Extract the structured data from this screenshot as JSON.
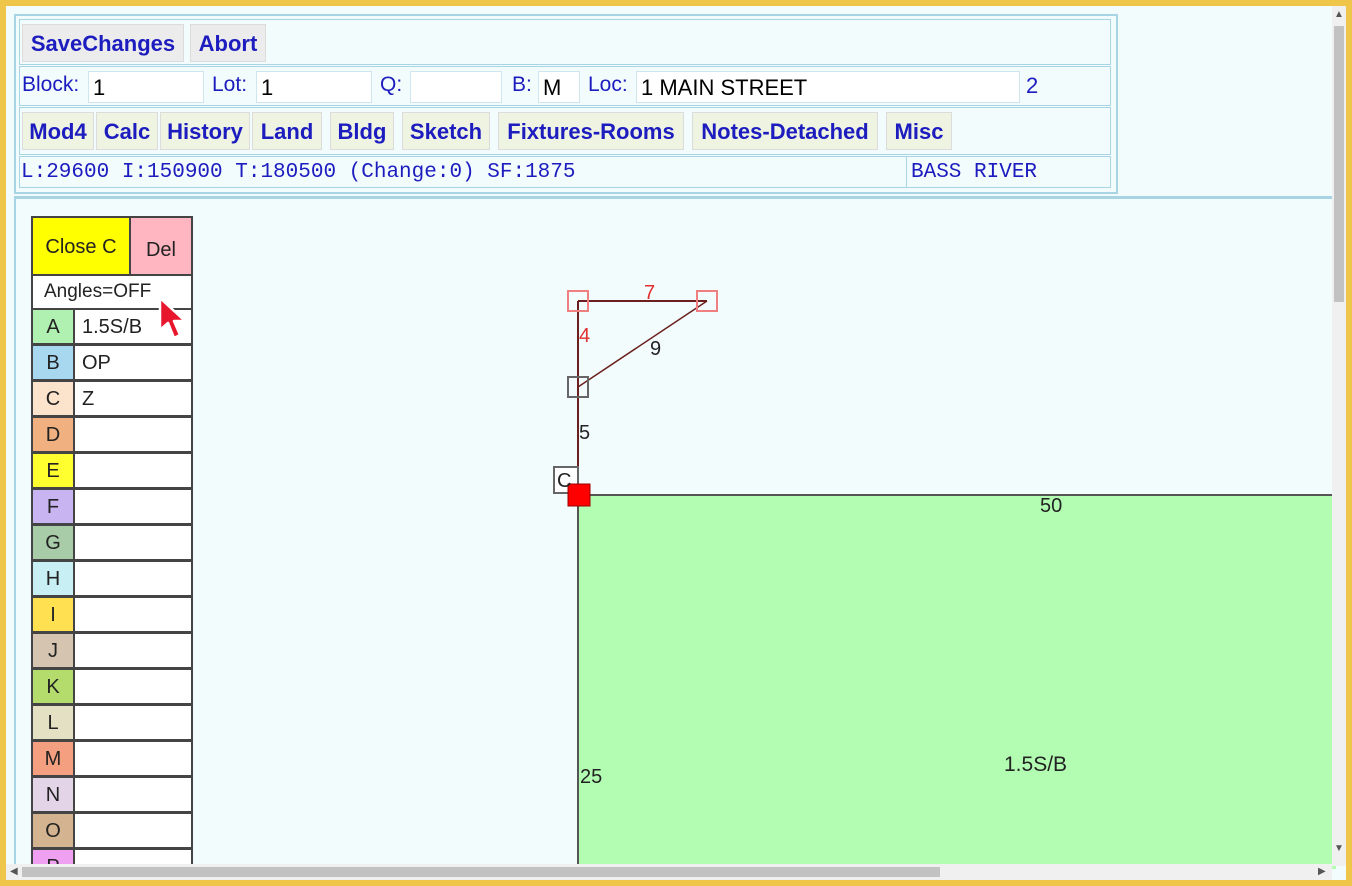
{
  "toolbar": {
    "save_label": "SaveChanges",
    "abort_label": "Abort"
  },
  "parcel": {
    "block_label": "Block:",
    "block_value": "1",
    "lot_label": "Lot:",
    "lot_value": "1",
    "q_label": "Q:",
    "q_value": "",
    "b_label": "B:",
    "b_value": "M",
    "loc_label": "Loc:",
    "loc_value": "1 MAIN STREET",
    "extra_value": "2"
  },
  "nav": {
    "items": [
      "Mod4",
      "Calc",
      "History",
      "Land",
      "Bldg",
      "Sketch",
      "Fixtures-Rooms",
      "Notes-Detached",
      "Misc"
    ]
  },
  "status": {
    "values_text": "L:29600 I:150900 T:180500 (Change:0) SF:1875",
    "town": "BASS RIVER"
  },
  "palette": {
    "close_label": "Close C",
    "del_label": "Del",
    "angles_label": "Angles=OFF",
    "close_color": "#ffff00",
    "del_color": "#ffb6c1",
    "rows": [
      {
        "letter": "A",
        "code": "1.5S/B",
        "color": "#b0f0b0"
      },
      {
        "letter": "B",
        "code": "OP",
        "color": "#a8d8f0"
      },
      {
        "letter": "C",
        "code": "Z",
        "color": "#fce4cc"
      },
      {
        "letter": "D",
        "code": "",
        "color": "#f0b080"
      },
      {
        "letter": "E",
        "code": "",
        "color": "#ffff30"
      },
      {
        "letter": "F",
        "code": "",
        "color": "#c8b4f0"
      },
      {
        "letter": "G",
        "code": "",
        "color": "#a8cca8"
      },
      {
        "letter": "H",
        "code": "",
        "color": "#c8f0f4"
      },
      {
        "letter": "I",
        "code": "",
        "color": "#ffe050"
      },
      {
        "letter": "J",
        "code": "",
        "color": "#d4c4b0"
      },
      {
        "letter": "K",
        "code": "",
        "color": "#b4dc6c"
      },
      {
        "letter": "L",
        "code": "",
        "color": "#e4e0c4"
      },
      {
        "letter": "M",
        "code": "",
        "color": "#f4a080"
      },
      {
        "letter": "N",
        "code": "",
        "color": "#e4d4e8"
      },
      {
        "letter": "O",
        "code": "",
        "color": "#d4b490"
      },
      {
        "letter": "P",
        "code": "",
        "color": "#f0a0f0"
      }
    ]
  },
  "sketch": {
    "dim_top": "7",
    "dim_left_upper": "4",
    "dim_diag": "9",
    "dim_left_mid": "5",
    "corner_label": "C",
    "dim_main_top": "50",
    "dim_main_left": "25",
    "area_label": "1.5S/B",
    "area_color": "#b3fdb3",
    "line_color": "#6b1f1f"
  }
}
